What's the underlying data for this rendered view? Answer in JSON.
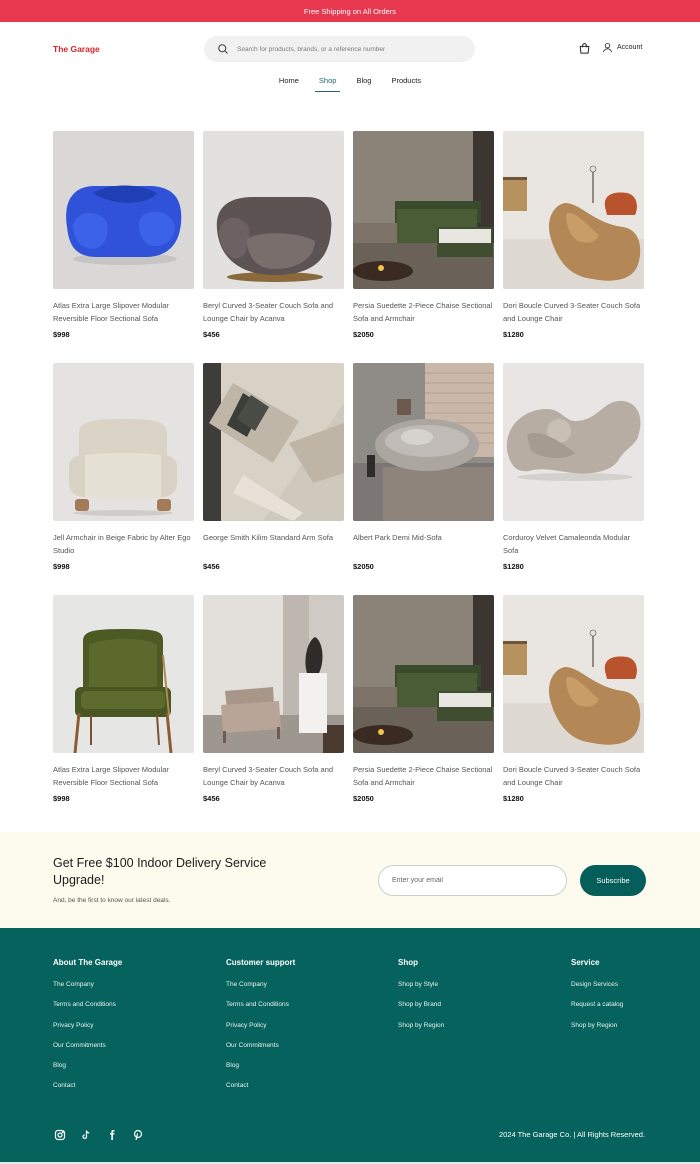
{
  "promo": {
    "text": "Free Shipping on All Orders"
  },
  "header": {
    "logo": "The Garage",
    "search_placeholder": "Search for products, brands, or a reference number",
    "account_label": "Account"
  },
  "nav": {
    "items": [
      {
        "label": "Home"
      },
      {
        "label": "Shop",
        "active": true
      },
      {
        "label": "Blog"
      },
      {
        "label": "Products"
      }
    ]
  },
  "products": [
    {
      "name": "Atlas Extra Large Slipover Modular Reversible Floor Sectional Sofa",
      "price": "$998"
    },
    {
      "name": "Beryl Curved 3-Seater Couch Sofa and Lounge Chair by Acanva",
      "price": "$456"
    },
    {
      "name": "Persia Suedette 2-Piece Chaise Sectional Sofa and Armchair",
      "price": "$2050"
    },
    {
      "name": "Dori Boucle Curved 3-Seater Couch Sofa and Lounge Chair",
      "price": "$1280"
    },
    {
      "name": "Jell Armchair in Beige Fabric by Alter Ego Studio",
      "price": "$998"
    },
    {
      "name": "George Smith Kilim Standard Arm Sofa",
      "price": "$456"
    },
    {
      "name": "Albert Park Demi Mid-Sofa",
      "price": "$2050"
    },
    {
      "name": " Corduroy Velvet Camaleonda Modular Sofa",
      "price": "$1280"
    },
    {
      "name": "Atlas Extra Large Slipover Modular Reversible Floor Sectional Sofa",
      "price": "$998"
    },
    {
      "name": "Beryl Curved 3-Seater Couch Sofa and Lounge Chair by Acanva",
      "price": "$456"
    },
    {
      "name": "Persia Suedette 2-Piece Chaise Sectional Sofa and Armchair",
      "price": "$2050"
    },
    {
      "name": "Dori Boucle Curved 3-Seater Couch Sofa and Lounge Chair",
      "price": "$1280"
    }
  ],
  "newsletter": {
    "title": "Get Free $100 Indoor Delivery Service Upgrade!",
    "subtitle": "And, be the first to know our latest deals.",
    "email_placeholder": "Enter your email",
    "button": "Subscribe"
  },
  "footer": {
    "columns": [
      {
        "title": "About The Garage",
        "links": [
          "The Company",
          "Terms and Conditions",
          "Privacy Policy",
          "Our Commitments",
          "Blog",
          "Contact"
        ]
      },
      {
        "title": "Customer support",
        "links": [
          "The Company",
          "Terms and Conditions",
          "Privacy Policy",
          "Our Commitments",
          "Blog",
          "Contact"
        ]
      },
      {
        "title": "Shop",
        "links": [
          "Shop by Style",
          "Shop by Brand",
          "Shop by Region"
        ]
      },
      {
        "title": "Service",
        "links": [
          "Design Services",
          "Request a catalog",
          "Shop by Region"
        ]
      }
    ],
    "socials": [
      "instagram-icon",
      "tiktok-icon",
      "facebook-icon",
      "pinterest-icon"
    ],
    "copyright": "2024 The Garage Co. | All Rights Reserved."
  },
  "colors": {
    "promo": "#e8384f",
    "logo": "#d8232a",
    "accent": "#05625c",
    "newsletter_bg": "#fdfaee"
  }
}
